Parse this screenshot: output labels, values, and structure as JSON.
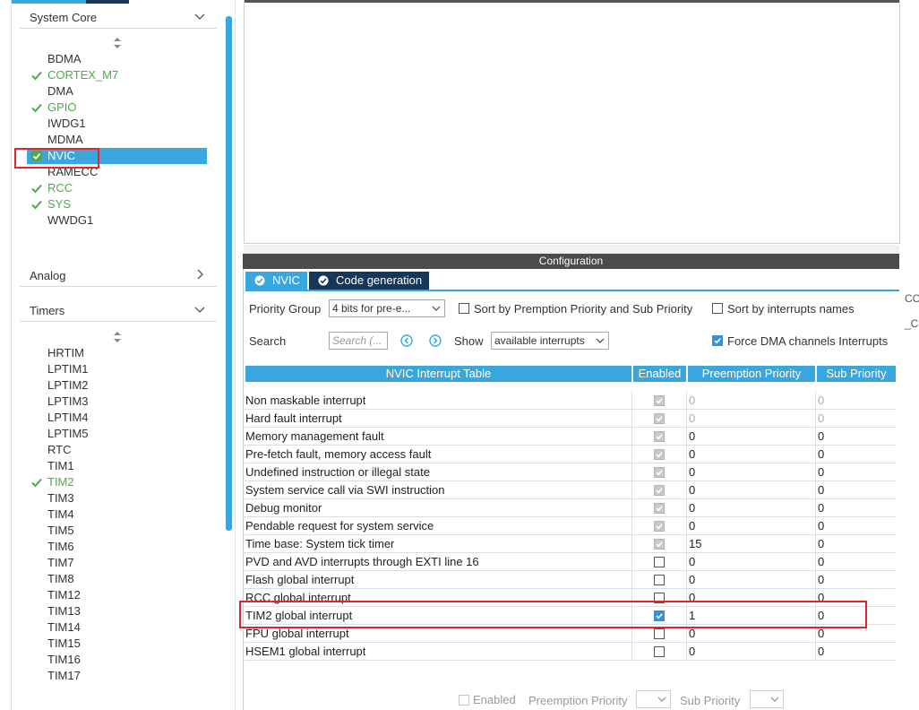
{
  "left_panel": {
    "categories": {
      "system_core": "System Core",
      "analog": "Analog",
      "timers": "Timers"
    },
    "system_core_items": [
      {
        "label": "BDMA",
        "enabled": false
      },
      {
        "label": "CORTEX_M7",
        "enabled": true
      },
      {
        "label": "DMA",
        "enabled": false
      },
      {
        "label": "GPIO",
        "enabled": true
      },
      {
        "label": "IWDG1",
        "enabled": false
      },
      {
        "label": "MDMA",
        "enabled": false
      },
      {
        "label": "NVIC",
        "enabled": true,
        "selected": true
      },
      {
        "label": "RAMECC",
        "enabled": false
      },
      {
        "label": "RCC",
        "enabled": true
      },
      {
        "label": "SYS",
        "enabled": true
      },
      {
        "label": "WWDG1",
        "enabled": false
      }
    ],
    "timers_items": [
      {
        "label": "HRTIM",
        "enabled": false
      },
      {
        "label": "LPTIM1",
        "enabled": false
      },
      {
        "label": "LPTIM2",
        "enabled": false
      },
      {
        "label": "LPTIM3",
        "enabled": false
      },
      {
        "label": "LPTIM4",
        "enabled": false
      },
      {
        "label": "LPTIM5",
        "enabled": false
      },
      {
        "label": "RTC",
        "enabled": false
      },
      {
        "label": "TIM1",
        "enabled": false
      },
      {
        "label": "TIM2",
        "enabled": true
      },
      {
        "label": "TIM3",
        "enabled": false
      },
      {
        "label": "TIM4",
        "enabled": false
      },
      {
        "label": "TIM5",
        "enabled": false
      },
      {
        "label": "TIM6",
        "enabled": false
      },
      {
        "label": "TIM7",
        "enabled": false
      },
      {
        "label": "TIM8",
        "enabled": false
      },
      {
        "label": "TIM12",
        "enabled": false
      },
      {
        "label": "TIM13",
        "enabled": false
      },
      {
        "label": "TIM14",
        "enabled": false
      },
      {
        "label": "TIM15",
        "enabled": false
      },
      {
        "label": "TIM16",
        "enabled": false
      },
      {
        "label": "TIM17",
        "enabled": false
      }
    ]
  },
  "config": {
    "title": "Configuration",
    "tabs": {
      "nvic": "NVIC",
      "code_generation": "Code generation"
    },
    "priority_group_label": "Priority Group",
    "priority_group_value": "4 bits for pre-e...",
    "sort_preemption_label": "Sort by Premption Priority and Sub Priority",
    "sort_names_label": "Sort by interrupts names",
    "search_label": "Search",
    "search_placeholder": "Search (...",
    "show_label": "Show",
    "show_value": "available interrupts",
    "force_dma_label": "Force DMA channels Interrupts",
    "force_dma_checked": true
  },
  "table": {
    "headers": {
      "name": "NVIC Interrupt Table",
      "enabled": "Enabled",
      "preemption": "Preemption Priority",
      "sub": "Sub Priority"
    },
    "rows": [
      {
        "name": "Non maskable interrupt",
        "enabled": "fixed",
        "pre": "0",
        "sub": "0",
        "locked": true
      },
      {
        "name": "Hard fault interrupt",
        "enabled": "fixed",
        "pre": "0",
        "sub": "0",
        "locked": true
      },
      {
        "name": "Memory management fault",
        "enabled": "fixed",
        "pre": "0",
        "sub": "0",
        "locked": false
      },
      {
        "name": "Pre-fetch fault, memory access fault",
        "enabled": "fixed",
        "pre": "0",
        "sub": "0",
        "locked": false
      },
      {
        "name": "Undefined instruction or illegal state",
        "enabled": "fixed",
        "pre": "0",
        "sub": "0",
        "locked": false
      },
      {
        "name": "System service call via SWI instruction",
        "enabled": "fixed",
        "pre": "0",
        "sub": "0",
        "locked": false
      },
      {
        "name": "Debug monitor",
        "enabled": "fixed",
        "pre": "0",
        "sub": "0",
        "locked": false
      },
      {
        "name": "Pendable request for system service",
        "enabled": "fixed",
        "pre": "0",
        "sub": "0",
        "locked": false
      },
      {
        "name": "Time base: System tick timer",
        "enabled": "fixed",
        "pre": "15",
        "sub": "0",
        "locked": false
      },
      {
        "name": "PVD and AVD interrupts through EXTI line 16",
        "enabled": "off",
        "pre": "0",
        "sub": "0",
        "locked": false
      },
      {
        "name": "Flash global interrupt",
        "enabled": "off",
        "pre": "0",
        "sub": "0",
        "locked": false
      },
      {
        "name": "RCC global interrupt",
        "enabled": "off",
        "pre": "0",
        "sub": "0",
        "locked": false
      },
      {
        "name": "TIM2 global interrupt",
        "enabled": "on",
        "pre": "1",
        "sub": "0",
        "locked": false
      },
      {
        "name": "FPU global interrupt",
        "enabled": "off",
        "pre": "0",
        "sub": "0",
        "locked": false
      },
      {
        "name": "HSEM1 global interrupt",
        "enabled": "off",
        "pre": "0",
        "sub": "0",
        "locked": false
      }
    ]
  },
  "bottom": {
    "enabled_label": "Enabled",
    "preemption_label": "Preemption Priority",
    "sub_label": "Sub Priority"
  },
  "edge_text": {
    "line1": "CC",
    "line2": "_C"
  },
  "colors": {
    "accent": "#39a7de",
    "dark_tab": "#163759",
    "enabled_green": "#4caa4c",
    "highlight_red": "#e0262b"
  }
}
